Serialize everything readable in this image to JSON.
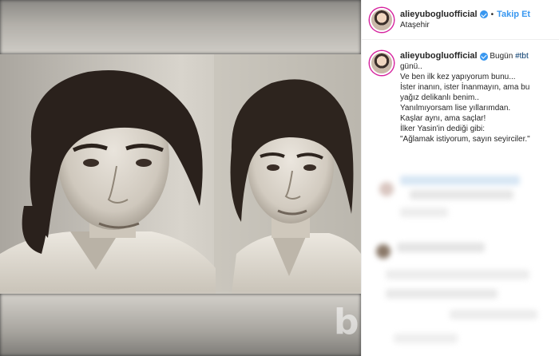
{
  "header": {
    "username": "alieyuboglu​official",
    "follow_label": "Takip Et",
    "separator": "•",
    "location": "Ataşehir"
  },
  "caption": {
    "username": "alieyuboglu​official",
    "lead": "Bugün",
    "hashtag": "#tbt",
    "lines": [
      "günü..",
      "Ve ben ilk kez yapıyorum bunu...",
      "İster inanın, ister İnanmayın, ama bu",
      "yağız delikanlı benim..",
      "Yanılmıyorsam lise yıllarımdan.",
      "Kaşlar aynı, ama saçlar!",
      "İlker Yasin'in dediği gibi:",
      "\"Ağlamak istiyorum, sayın seyirciler.\""
    ]
  },
  "icons": {
    "verified": "verified-badge-icon",
    "avatar": "profile-avatar"
  },
  "colors": {
    "link": "#3897f0",
    "hashtag": "#00376b",
    "text": "#262626"
  }
}
